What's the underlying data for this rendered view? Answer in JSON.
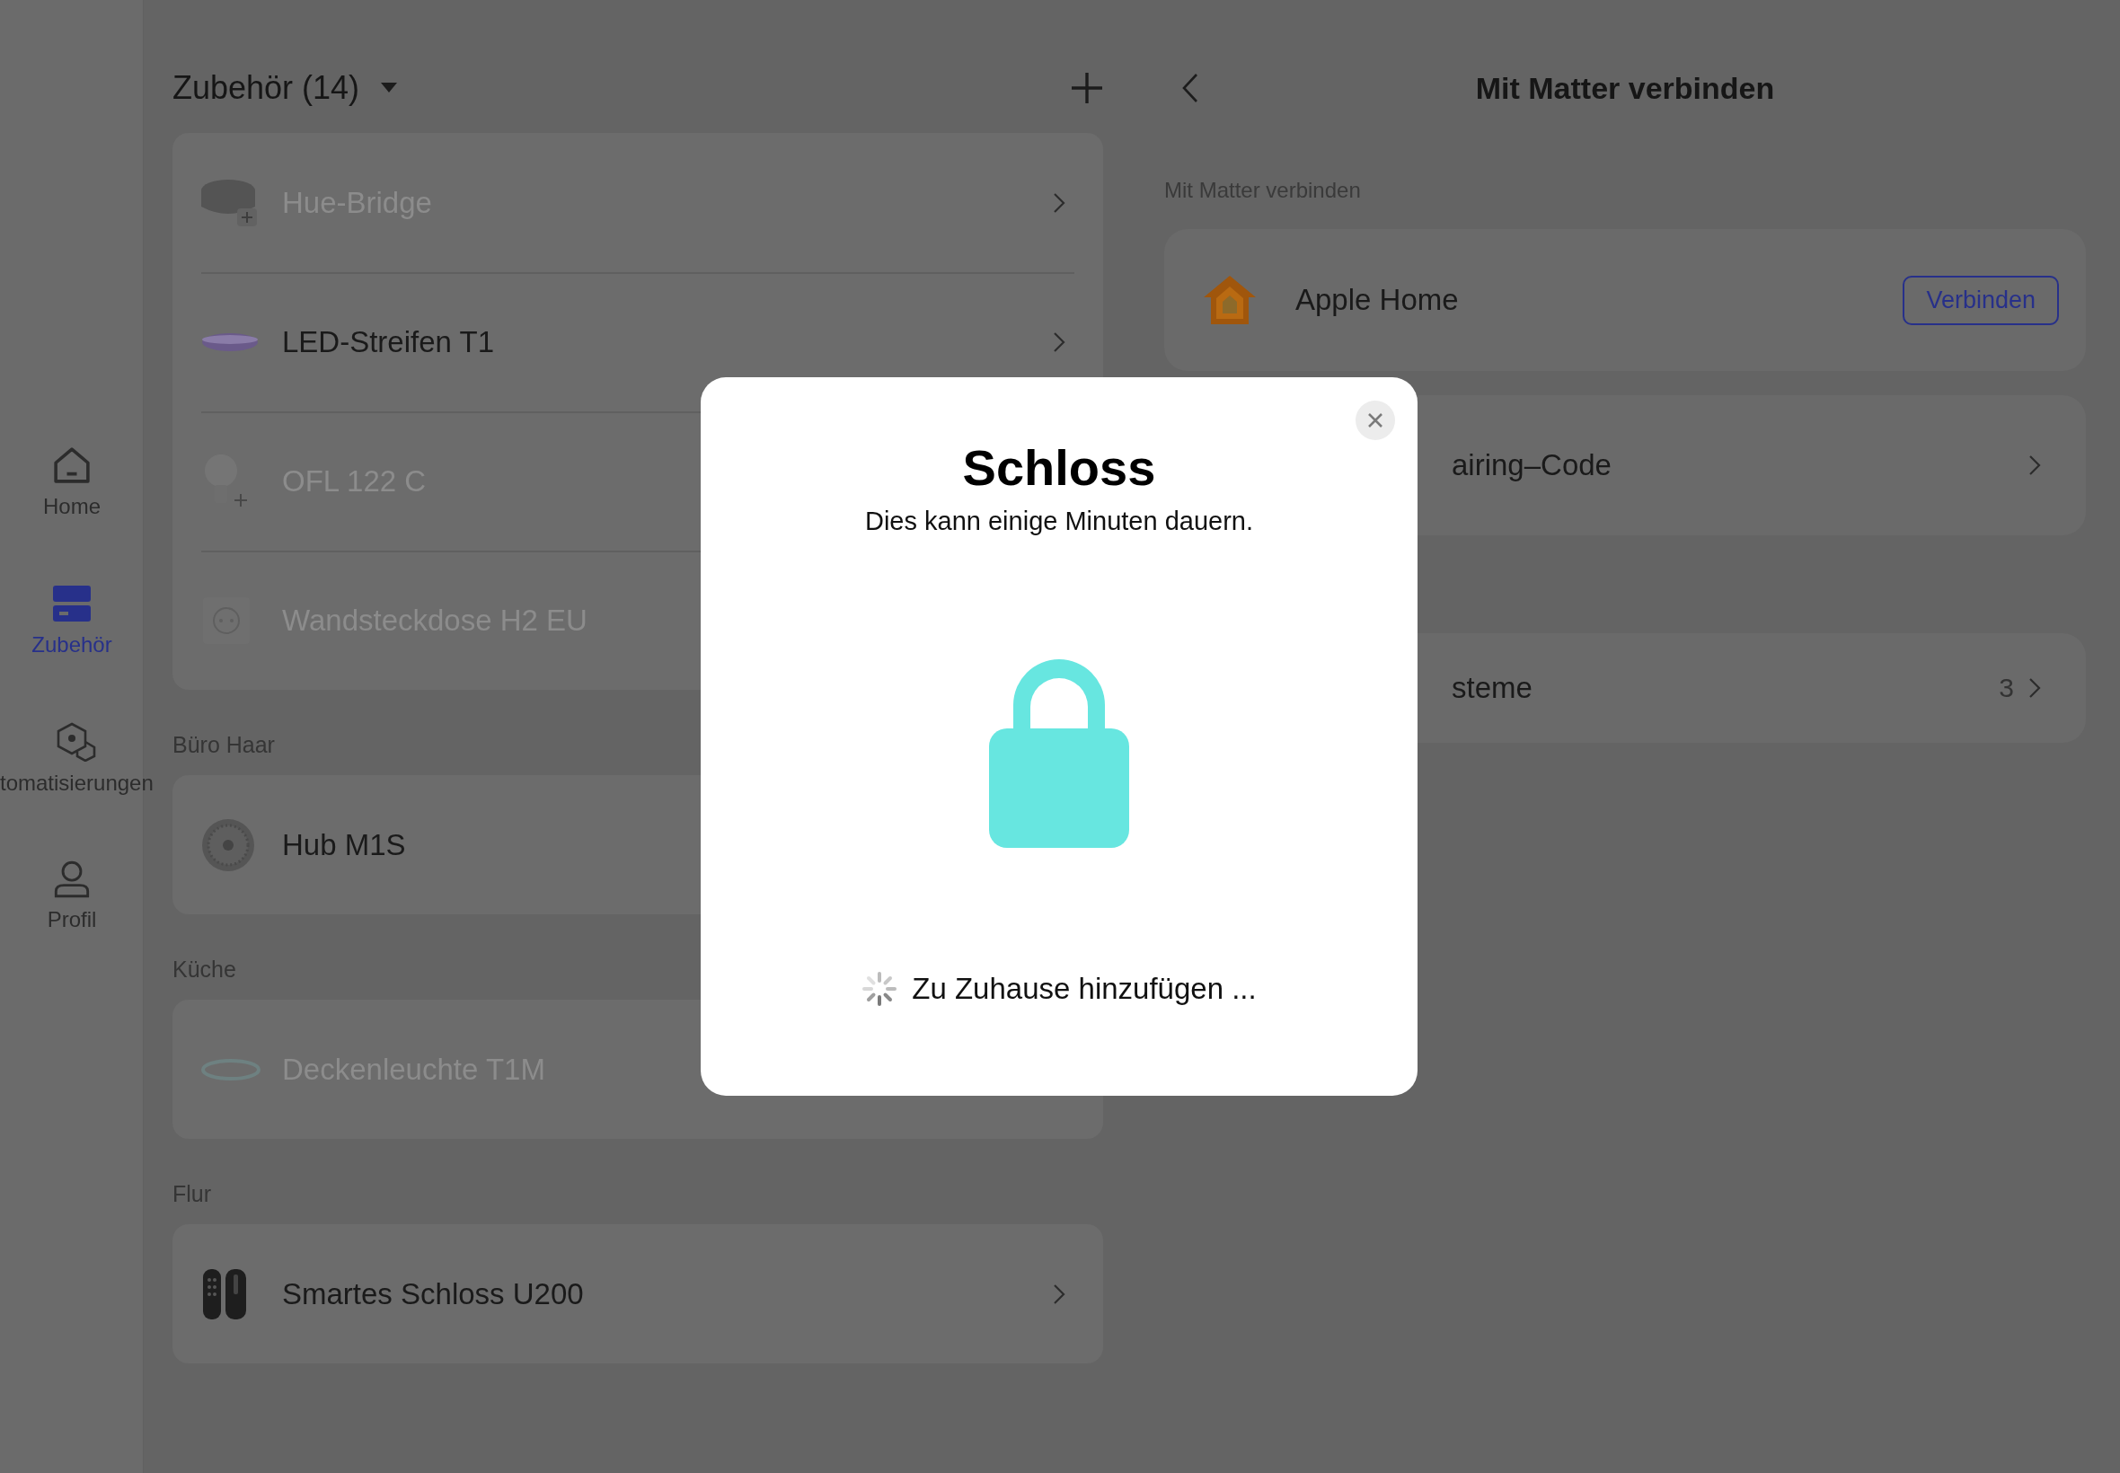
{
  "sidebar": {
    "items": [
      {
        "label": "Home",
        "kind": "home",
        "selected": false
      },
      {
        "label": "Zubehör",
        "kind": "accessories",
        "selected": true
      },
      {
        "label": "tomatisierungen",
        "kind": "automation",
        "selected": false
      },
      {
        "label": "Profil",
        "kind": "profile",
        "selected": false
      }
    ]
  },
  "accessories": {
    "title": "Zubehör (14)",
    "sections": [
      {
        "devices": [
          {
            "name": "Hue-Bridge",
            "kind": "bridge",
            "offline": true
          },
          {
            "name": "LED-Streifen T1",
            "kind": "strip",
            "offline": false
          },
          {
            "name": "OFL 122 C",
            "kind": "bulb",
            "offline": true
          },
          {
            "name": "Wandsteckdose H2 EU",
            "kind": "socket",
            "offline": true
          }
        ]
      },
      {
        "label": "Büro Haar",
        "devices": [
          {
            "name": "Hub M1S",
            "kind": "hub",
            "offline": false
          }
        ]
      },
      {
        "label": "Küche",
        "devices": [
          {
            "name": "Deckenleuchte T1M",
            "kind": "ceiling",
            "offline": true
          }
        ]
      },
      {
        "label": "Flur",
        "devices": [
          {
            "name": "Smartes Schloss U200",
            "kind": "lock",
            "offline": false
          }
        ]
      }
    ]
  },
  "matter": {
    "title": "Mit Matter verbinden",
    "section_label": "Mit Matter verbinden",
    "rows": [
      {
        "kind": "connect",
        "name": "Apple Home",
        "button": "Verbinden"
      },
      {
        "kind": "link",
        "name": "airing–Code"
      },
      {
        "kind": "count",
        "name": "steme",
        "count": "3"
      }
    ]
  },
  "dialog": {
    "title": "Schloss",
    "subtitle": "Dies kann einige Minuten dauern.",
    "status": "Zu Zuhause hinzufügen ..."
  }
}
